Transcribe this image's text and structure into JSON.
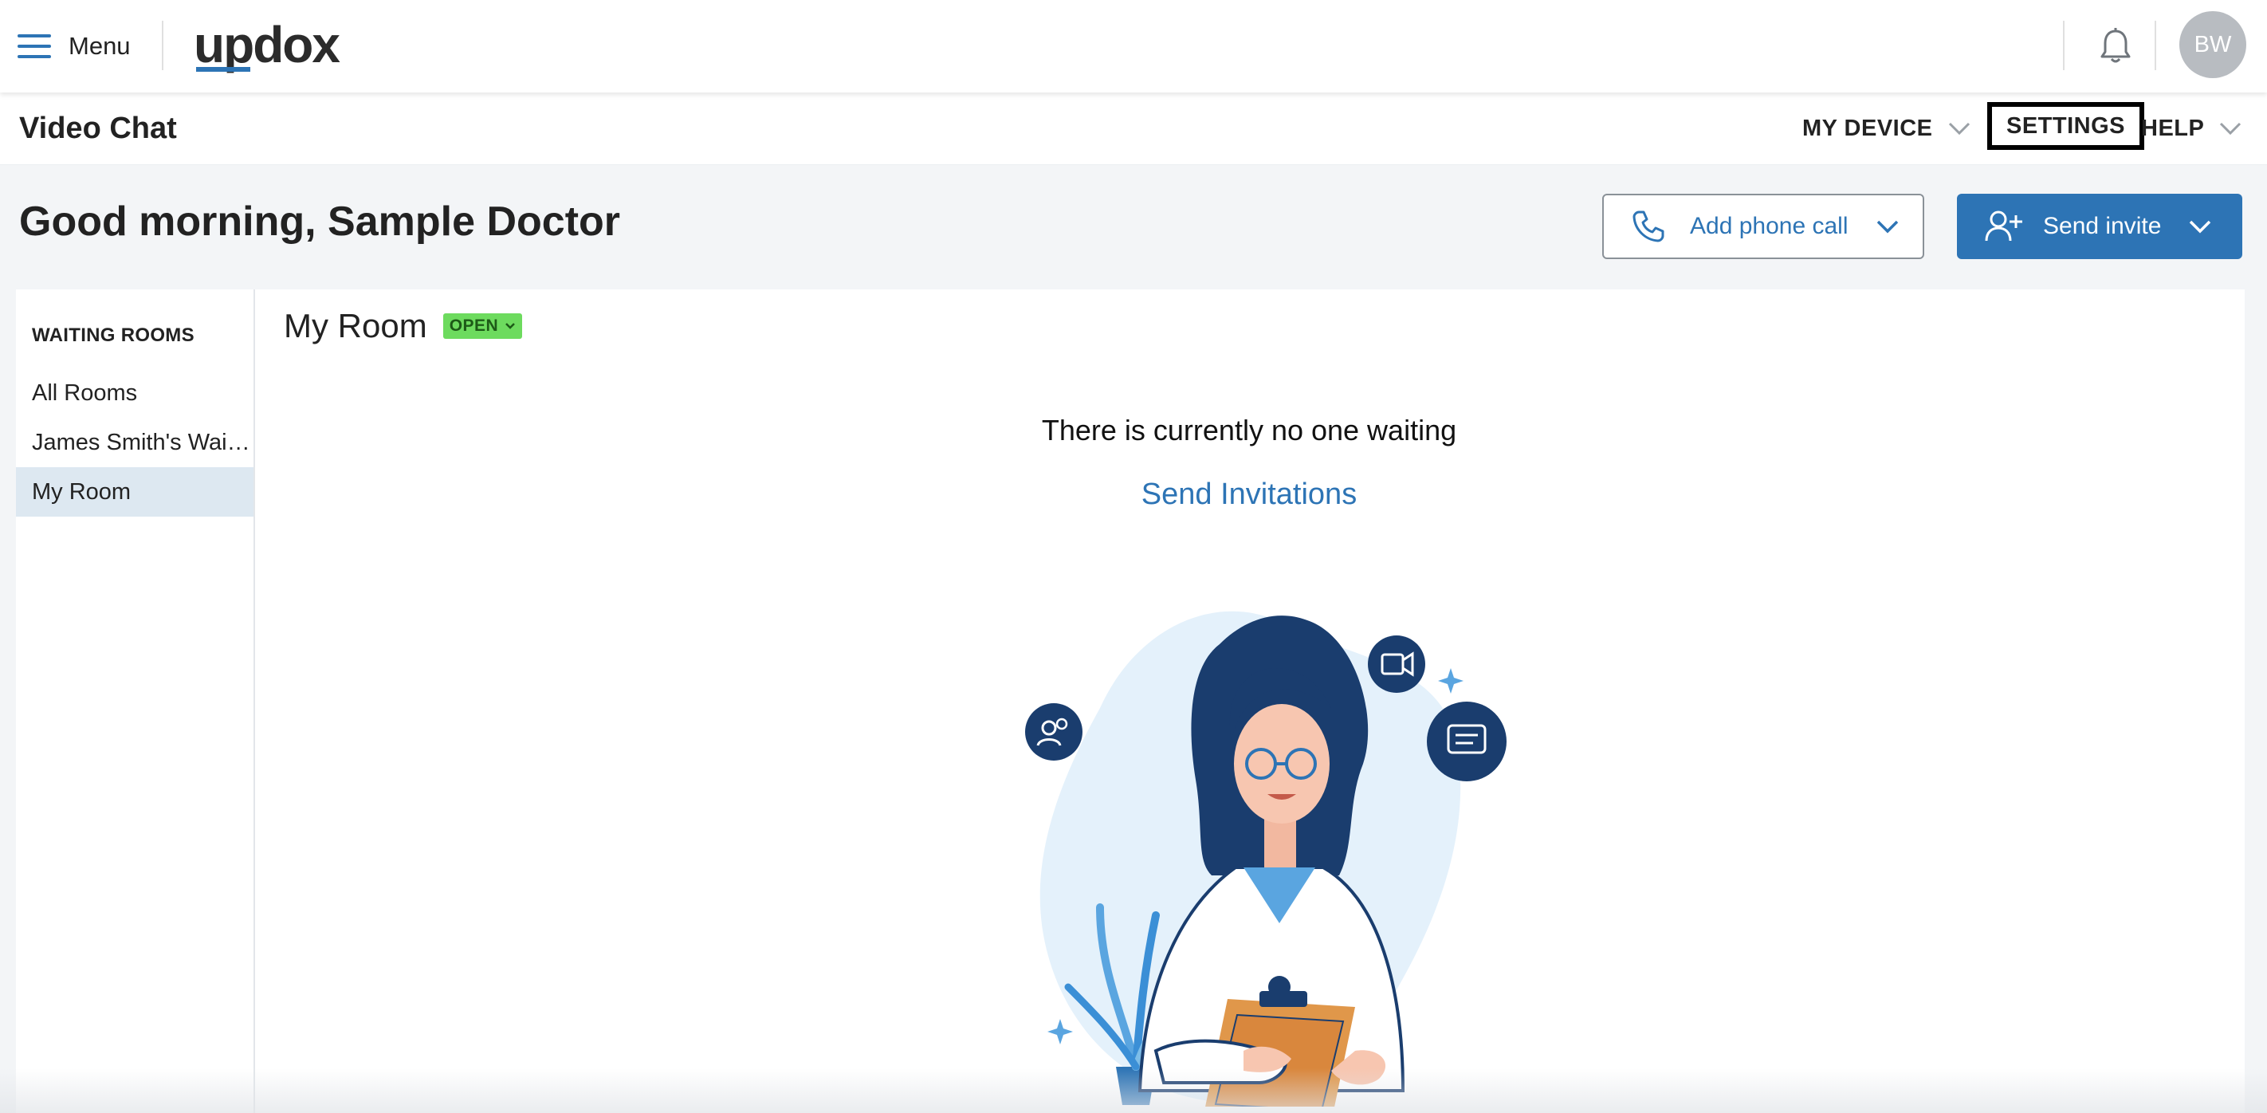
{
  "topbar": {
    "menu_label": "Menu",
    "logo_prefix": "up",
    "logo_suffix": "dox",
    "avatar_initials": "BW",
    "icons": [
      "hamburger-icon",
      "bell-icon"
    ]
  },
  "subheader": {
    "title": "Video Chat",
    "nav": [
      {
        "label": "MY DEVICE",
        "has_dropdown": true
      },
      {
        "label": "SETTINGS",
        "has_dropdown": false,
        "highlighted": true
      },
      {
        "label": "HELP",
        "has_dropdown": true
      }
    ]
  },
  "greeting": "Good morning, Sample Doctor",
  "actions": {
    "add_phone_label": "Add phone call",
    "send_invite_label": "Send invite"
  },
  "sidebar": {
    "heading": "WAITING ROOMS",
    "items": [
      {
        "label": "All Rooms",
        "active": false
      },
      {
        "label": "James Smith's Waiting Room",
        "active": false
      },
      {
        "label": "My Room",
        "active": true
      }
    ]
  },
  "room": {
    "title": "My Room",
    "status_badge": "OPEN",
    "empty_message": "There is currently no one waiting",
    "send_invitations_link": "Send Invitations"
  },
  "colors": {
    "accent": "#2d74b5",
    "badge_green": "#6ddb5e",
    "active_item": "#dde8f1",
    "page_bg": "#f3f5f7"
  }
}
